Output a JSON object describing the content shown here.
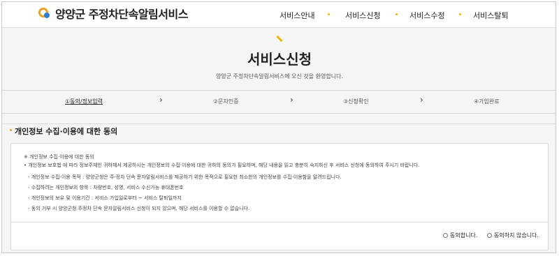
{
  "header": {
    "logo_text": "양양군 주정차단속알림서비스",
    "nav": [
      "서비스안내",
      "서비스신청",
      "서비스수정",
      "서비스탈퇴"
    ]
  },
  "hero": {
    "title": "서비스신청",
    "subtitle": "양양군 주정차단속알림서비스에 오신 것을 환영합니다."
  },
  "steps": [
    "①동의/정보입력",
    "②문자인증",
    "③신청확인",
    "④가입완료"
  ],
  "step_arrow": "›",
  "section": {
    "title": "개인정보 수집·이용에 대한 동의",
    "body": [
      "※ 개인정보 수집·이용에 대한 동의",
      "• 개인정보 보호법 에 따라 정보주체인 귀하께서 제공하시는 개인정보의 수집·이용에 대한 귀하의 동의가 필요하며, 해당 내용을 읽고 충분히 숙지하신 후 서비스 신청에 동의하여 주시기 바랍니다.",
      "- 개인정보 수집·이용 목적 : 양양군청은 주·정차 단속 문자알림서비스를 제공하기 위한 목적으로 필요한 최소한의 개인정보를 수집·이용함을 알려드립니다.",
      "- 수집하려는 개인정보의 항목 : 차량번호, 성명, 서비스 수신가능 휴대폰번호",
      "- 개인정보의 보유 및 이용기간 : 서비스 가입일로부터 ~ 서비스 탈퇴일까지",
      "- 동의 거부 시 양양군청 주정차 단속 문자알림서비스 신청이 되지 않으며, 해당 서비스를 이용할 수 없습니다."
    ]
  },
  "consent": {
    "agree": "동의합니다.",
    "disagree": "동의하지 않습니다."
  }
}
